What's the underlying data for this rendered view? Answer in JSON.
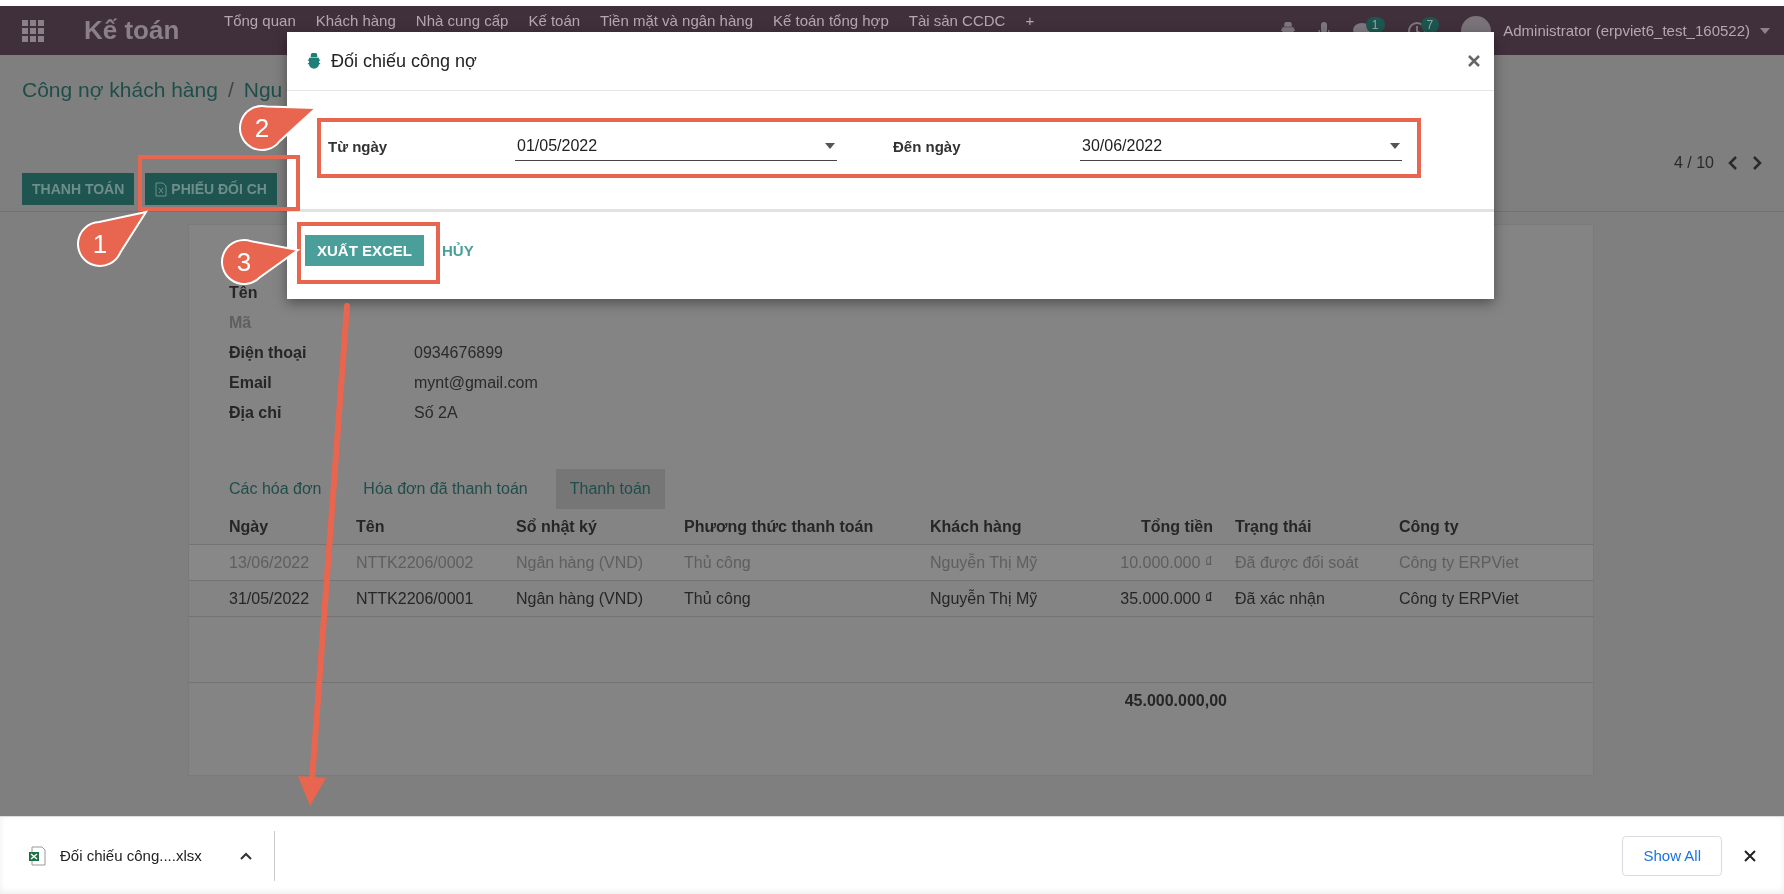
{
  "navbar": {
    "app_title": "Kế toán",
    "menu": [
      "Tổng quan",
      "Khách hàng",
      "Nhà cung cấp",
      "Kế toán",
      "Tiền mặt và ngân hàng",
      "Kế toán tổng hợp",
      "Tài sản CCDC",
      "+"
    ],
    "chat_badge": "1",
    "activity_badge": "7",
    "user": "Administrator (erpviet6_test_160522)"
  },
  "breadcrumb": {
    "parent": "Công nợ khách hàng",
    "separator": "/",
    "current": "Ngu"
  },
  "pager": "4 / 10",
  "actions": [
    "THANH TOÁN",
    "PHIẾU ĐỐI CH"
  ],
  "fields": [
    {
      "label": "Tên",
      "muted": false
    },
    {
      "label": "Mã",
      "muted": true
    },
    {
      "label": "Điện thoại",
      "value": "0934676899",
      "muted": false
    },
    {
      "label": "Email",
      "value": "mynt@gmail.com",
      "muted": false
    },
    {
      "label": "Địa chỉ",
      "value": "Số 2A",
      "muted": false
    }
  ],
  "tabs": [
    {
      "label": "Các hóa đơn",
      "selected": false
    },
    {
      "label": "Hóa đơn đã thanh toán",
      "selected": false
    },
    {
      "label": "Thanh toán",
      "selected": true
    }
  ],
  "table": {
    "columns": [
      "Ngày",
      "Tên",
      "Sổ nhật ký",
      "Phương thức thanh toán",
      "Khách hàng",
      "Tổng tiền",
      "Trạng thái",
      "Công ty"
    ],
    "rows": [
      {
        "cells": [
          "13/06/2022",
          "NTTK2206/0002",
          "Ngân hàng (VND)",
          "Thủ công",
          "Nguyễn Thị Mỹ",
          "10.000.000 ₫",
          "Đã được đối soát",
          "Công ty ERPViet"
        ],
        "muted": true
      },
      {
        "cells": [
          "31/05/2022",
          "NTTK2206/0001",
          "Ngân hàng (VND)",
          "Thủ công",
          "Nguyễn Thị Mỹ",
          "35.000.000 ₫",
          "Đã xác nhận",
          "Công ty ERPViet"
        ],
        "muted": false
      }
    ],
    "total": "45.000.000,00"
  },
  "dialog": {
    "title": "Đối chiếu công nợ",
    "fields": [
      {
        "label": "Từ ngày",
        "value": "01/05/2022"
      },
      {
        "label": "Đến ngày",
        "value": "30/06/2022"
      }
    ],
    "buttons": [
      {
        "label": "XUẤT EXCEL",
        "kind": "primary"
      },
      {
        "label": "HỦY",
        "kind": "link"
      }
    ]
  },
  "annotations": [
    "1",
    "2",
    "3"
  ],
  "download_bar": {
    "file": "Đối chiếu công....xlsx",
    "show_all": "Show All"
  }
}
